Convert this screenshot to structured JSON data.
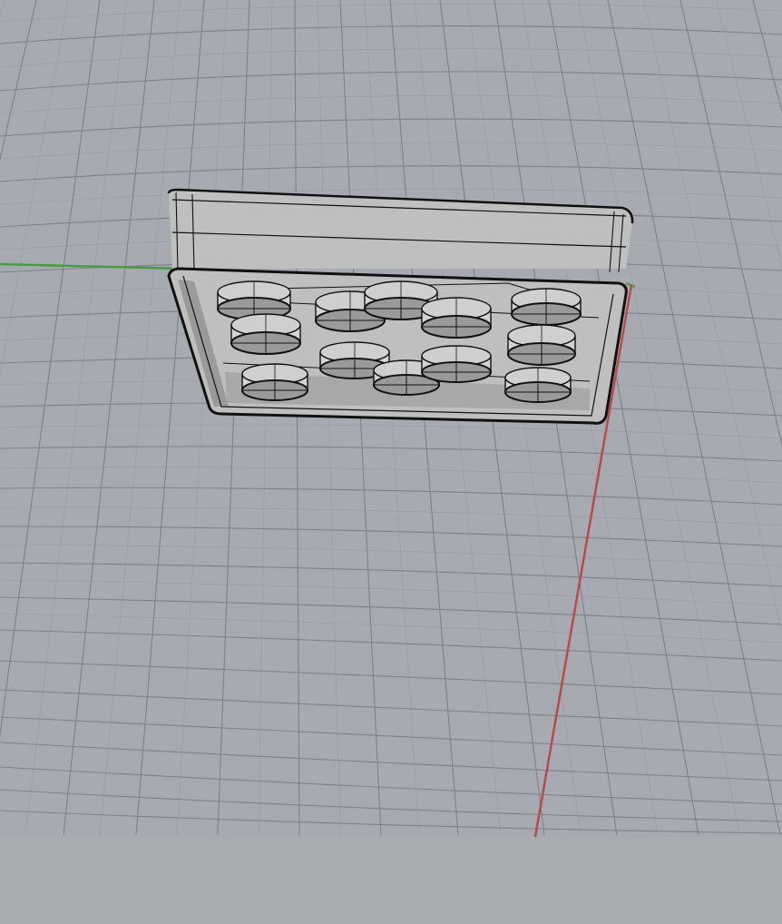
{
  "viewport": {
    "background_color": "#a7abb1",
    "grid_color": "#8e939b",
    "grid_major_color": "#7d8189",
    "x_axis_color": "#b84a4a",
    "y_axis_color": "#4a9a45",
    "model_fill_color": "#bfbfbf",
    "model_shadow_color": "#9a9a9a",
    "model_edge_color": "#111111"
  }
}
